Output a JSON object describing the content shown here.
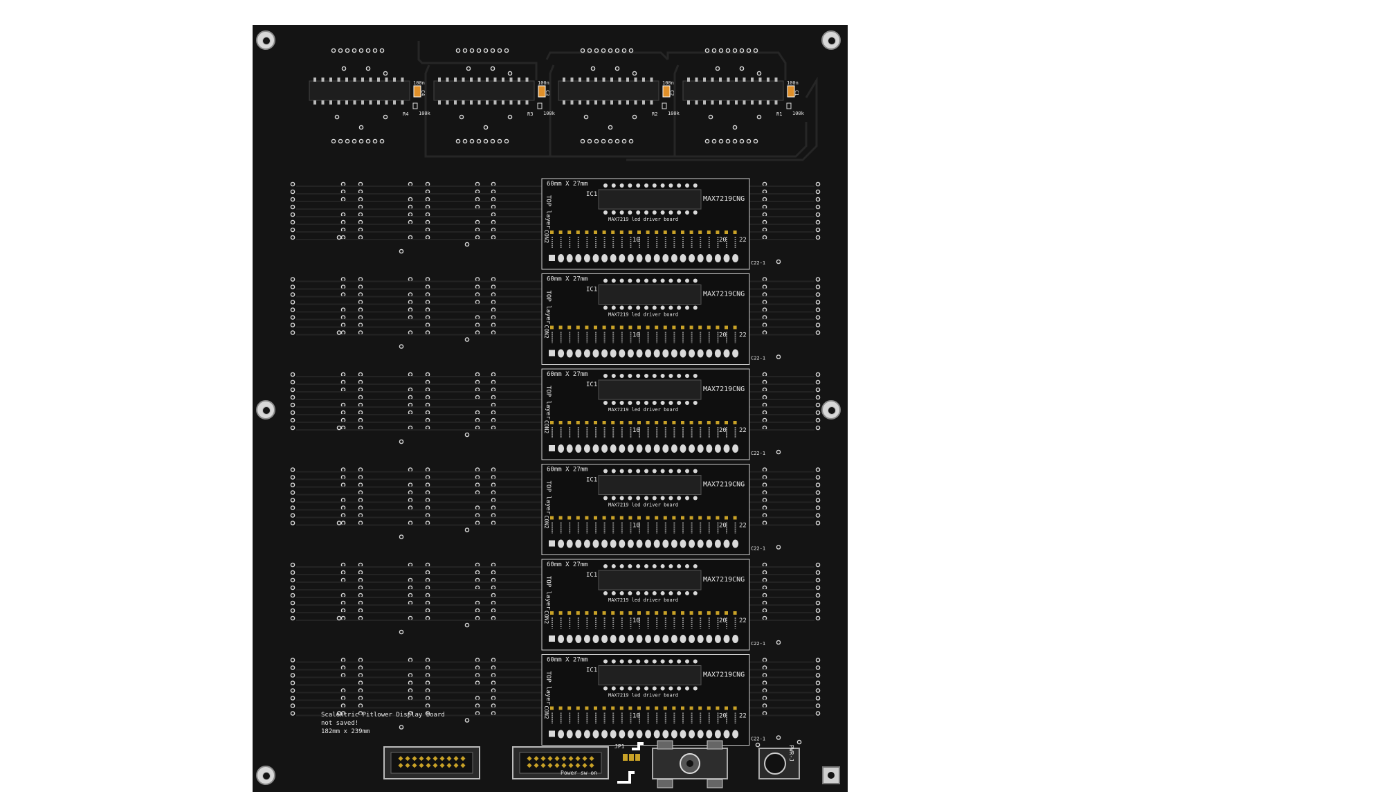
{
  "board": {
    "notes": [
      "Scalextric Pitlower Display board",
      "not saved!",
      "182mm x 239mm"
    ],
    "top_row_ic_count": 4,
    "top_labels": {
      "cap": "100n",
      "res": "100k",
      "refs": [
        {
          "c": "C4",
          "r": "R4"
        },
        {
          "c": "C3",
          "r": "R3"
        },
        {
          "c": "C2",
          "r": "R2"
        },
        {
          "c": "C1",
          "r": "R1"
        }
      ]
    },
    "modules": [
      {
        "size": "60mm X 27mm",
        "layer": "TOP layer",
        "ic": "IC1",
        "chip": "MAX7219CNG",
        "caption": "MAX7219 led driver board",
        "con": "CON2",
        "n1": "10",
        "n2": "20",
        "pins": "22",
        "ref": "C22-1"
      },
      {
        "size": "60mm X 27mm",
        "layer": "TOP layer",
        "ic": "IC1",
        "chip": "MAX7219CNG",
        "caption": "MAX7219 led driver board",
        "con": "CON2",
        "n1": "10",
        "n2": "20",
        "pins": "22",
        "ref": "C22-1"
      },
      {
        "size": "60mm X 27mm",
        "layer": "TOP layer",
        "ic": "IC1",
        "chip": "MAX7219CNG",
        "caption": "MAX7219 led driver board",
        "con": "CON2",
        "n1": "10",
        "n2": "20",
        "pins": "22",
        "ref": "C22-1"
      },
      {
        "size": "60mm X 27mm",
        "layer": "TOP layer",
        "ic": "IC1",
        "chip": "MAX7219CNG",
        "caption": "MAX7219 led driver board",
        "con": "CON2",
        "n1": "10",
        "n2": "20",
        "pins": "22",
        "ref": "C22-1"
      },
      {
        "size": "60mm X 27mm",
        "layer": "TOP layer",
        "ic": "IC1",
        "chip": "MAX7219CNG",
        "caption": "MAX7219 led driver board",
        "con": "CON2",
        "n1": "10",
        "n2": "20",
        "pins": "22",
        "ref": "C22-1"
      },
      {
        "size": "60mm X 27mm",
        "layer": "TOP layer",
        "ic": "IC1",
        "chip": "MAX7219CNG",
        "caption": "MAX7219 led driver board",
        "con": "CON2",
        "n1": "10",
        "n2": "20",
        "pins": "22",
        "ref": "C22-1"
      }
    ],
    "bottom": {
      "jumper": "JP1",
      "power": "Power sw on",
      "jack": "PWR-J"
    },
    "colors": {
      "board": "#141414",
      "silk": "#e8e8e8",
      "pad": "#d9d9d9",
      "gold": "#c9a227",
      "copper": "#e0902a"
    }
  }
}
